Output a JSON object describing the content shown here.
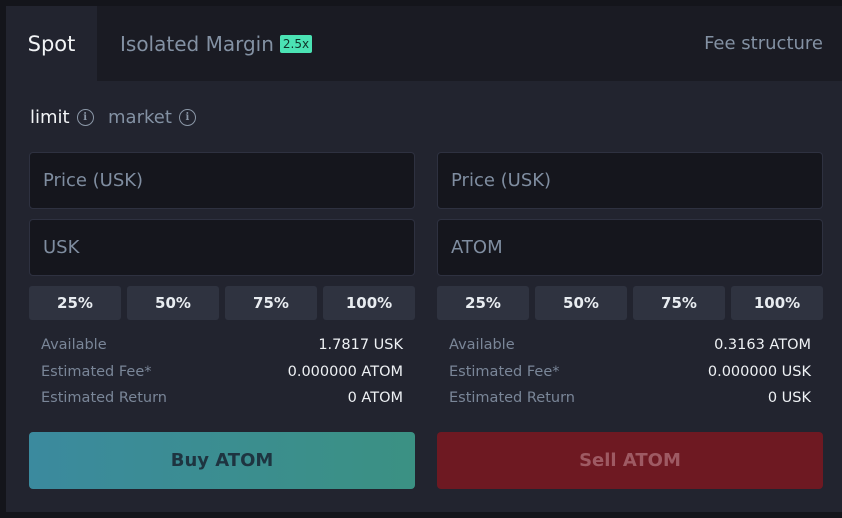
{
  "tabs": {
    "spot": "Spot",
    "isolated_margin": "Isolated Margin",
    "leverage_badge": "2.5x",
    "fee_structure": "Fee structure"
  },
  "order_types": {
    "limit": "limit",
    "market": "market"
  },
  "buy": {
    "price_placeholder": "Price (USK)",
    "amount_placeholder": "USK",
    "percentages": [
      "25%",
      "50%",
      "75%",
      "100%"
    ],
    "available_label": "Available",
    "available_value": "1.7817 USK",
    "fee_label": "Estimated Fee*",
    "fee_value": "0.000000 ATOM",
    "return_label": "Estimated Return",
    "return_value": "0 ATOM",
    "button": "Buy ATOM"
  },
  "sell": {
    "price_placeholder": "Price (USK)",
    "amount_placeholder": "ATOM",
    "percentages": [
      "25%",
      "50%",
      "75%",
      "100%"
    ],
    "available_label": "Available",
    "available_value": "0.3163 ATOM",
    "fee_label": "Estimated Fee*",
    "fee_value": "0.000000 USK",
    "return_label": "Estimated Return",
    "return_value": "0 USK",
    "button": "Sell ATOM"
  },
  "colors": {
    "accent": "#4be3b4",
    "buy_button": "#3b8a9e",
    "sell_button": "#6e1922"
  },
  "icons": {
    "info": "info-circle-icon"
  }
}
